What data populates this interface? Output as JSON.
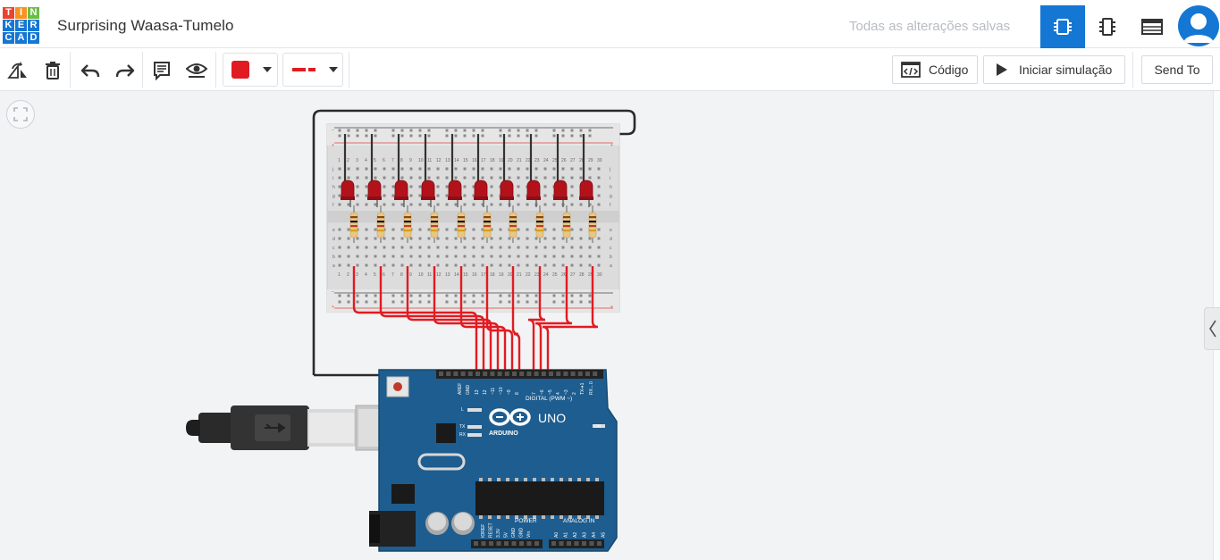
{
  "header": {
    "logo_letters": [
      "T",
      "I",
      "N",
      "K",
      "E",
      "R",
      "C",
      "A",
      "D"
    ],
    "project_title": "Surprising Waasa-Tumelo",
    "save_status": "Todas as alterações salvas",
    "tabs": [
      {
        "icon": "circuit-view-icon",
        "active": true
      },
      {
        "icon": "component-list-icon",
        "active": false
      },
      {
        "icon": "bill-of-materials-icon",
        "active": false
      }
    ],
    "avatar_icon": "user-avatar-icon"
  },
  "toolbar": {
    "tools": [
      "rotate-icon",
      "delete-icon",
      "undo-icon",
      "redo-icon",
      "notes-icon",
      "visibility-icon"
    ],
    "wire_color": "#e11b22",
    "wire_style_icon": "dashed-line-icon",
    "code_label": "Código",
    "simulate_label": "Iniciar simulação",
    "send_to_label": "Send To"
  },
  "canvas": {
    "fit_icon": "fit-view-icon",
    "collapse_icon": "chevron-left-icon",
    "breadboard": {
      "row_letters_top": [
        "j",
        "i",
        "h",
        "g",
        "f"
      ],
      "row_letters_bottom": [
        "e",
        "d",
        "c",
        "b",
        "a"
      ],
      "column_numbers": [
        "1",
        "2",
        "3",
        "4",
        "5",
        "6",
        "7",
        "8",
        "9",
        "10",
        "11",
        "12",
        "13",
        "14",
        "15",
        "16",
        "17",
        "18",
        "19",
        "20",
        "21",
        "22",
        "23",
        "24",
        "25",
        "26",
        "27",
        "28",
        "29",
        "30"
      ]
    },
    "led_count": 10,
    "resistor_count": 10,
    "arduino": {
      "brand": "ARDUINO",
      "model": "UNO",
      "digital_label": "DIGITAL (PWM ~)",
      "power_label": "POWER",
      "analog_label": "ANALOG IN",
      "on_label": "ON",
      "led_labels": [
        "L",
        "TX",
        "RX"
      ],
      "digital_pins": [
        "AREF",
        "GND",
        "13",
        "12",
        "~11",
        "~10",
        "~9",
        "8",
        "7",
        "~6",
        "~5",
        "4",
        "~3",
        "2",
        "TX➔1",
        "RX←0"
      ],
      "power_pins": [
        "IOREF",
        "RESET",
        "3.3V",
        "5V",
        "GND",
        "GND",
        "Vin"
      ],
      "analog_pins": [
        "A0",
        "A1",
        "A2",
        "A3",
        "A4",
        "A5"
      ]
    },
    "colors": {
      "wire_red": "#e11b22",
      "wire_black": "#2b2b2b",
      "board_blue": "#1e5d8f",
      "led_red": "#b3121b"
    }
  }
}
